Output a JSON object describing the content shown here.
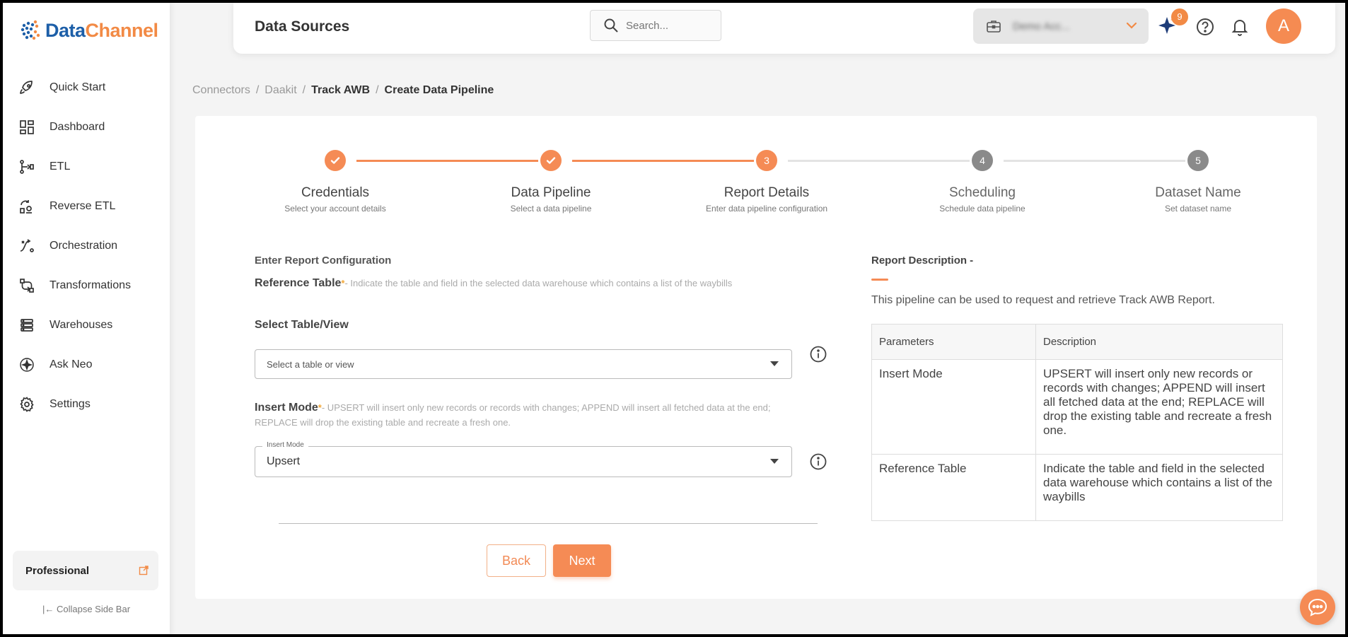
{
  "brand": {
    "name_part1": "Data",
    "name_part2": "Channel",
    "primary": "#1d5fa8",
    "accent": "#f28a45"
  },
  "sidebar": {
    "items": [
      {
        "label": "Quick Start",
        "icon": "rocket-icon"
      },
      {
        "label": "Dashboard",
        "icon": "dashboard-icon"
      },
      {
        "label": "ETL",
        "icon": "etl-icon"
      },
      {
        "label": "Reverse ETL",
        "icon": "reverse-etl-icon"
      },
      {
        "label": "Orchestration",
        "icon": "orchestration-icon"
      },
      {
        "label": "Transformations",
        "icon": "transformations-icon"
      },
      {
        "label": "Warehouses",
        "icon": "warehouses-icon"
      },
      {
        "label": "Ask Neo",
        "icon": "sparkle-icon"
      },
      {
        "label": "Settings",
        "icon": "gear-icon"
      }
    ],
    "plan": "Professional",
    "collapse_label": "Collapse Side Bar"
  },
  "header": {
    "title": "Data Sources",
    "search_placeholder": "Search...",
    "account_name": "Demo Acc...",
    "notification_count": "9",
    "avatar_letter": "A"
  },
  "breadcrumb": {
    "items": [
      "Connectors",
      "Daakit",
      "Track AWB"
    ],
    "current": "Create Data Pipeline"
  },
  "stepper": {
    "steps": [
      {
        "number": "1",
        "title": "Credentials",
        "subtitle": "Select your account details",
        "state": "done"
      },
      {
        "number": "2",
        "title": "Data Pipeline",
        "subtitle": "Select a data pipeline",
        "state": "done"
      },
      {
        "number": "3",
        "title": "Report Details",
        "subtitle": "Enter data pipeline configuration",
        "state": "active"
      },
      {
        "number": "4",
        "title": "Scheduling",
        "subtitle": "Schedule data pipeline",
        "state": "pending"
      },
      {
        "number": "5",
        "title": "Dataset Name",
        "subtitle": "Set dataset name",
        "state": "pending"
      }
    ]
  },
  "form": {
    "section_title": "Enter Report Configuration",
    "reference_table": {
      "label": "Reference Table",
      "required": "*",
      "help": "- Indicate the table and field in the selected data warehouse which contains a list of the waybills"
    },
    "select_table_label": "Select Table/View",
    "select_table_placeholder": "Select a table or view",
    "insert_mode": {
      "label": "Insert Mode",
      "required": "*",
      "help": "- UPSERT will insert only new records or records with changes; APPEND will insert all fetched data at the end; REPLACE will drop the existing table and recreate a fresh one.",
      "field_label": "Insert Mode",
      "value": "Upsert"
    },
    "back_label": "Back",
    "next_label": "Next"
  },
  "description": {
    "title": "Report Description -",
    "text": "This pipeline can be used to request and retrieve Track AWB Report.",
    "table": {
      "headers": [
        "Parameters",
        "Description"
      ],
      "rows": [
        [
          "Insert Mode",
          "UPSERT will insert only new records or records with changes; APPEND will insert all fetched data at the end; REPLACE will drop the existing table and recreate a fresh one."
        ],
        [
          "Reference Table",
          "Indicate the table and field in the selected data warehouse which contains a list of the waybills"
        ]
      ]
    }
  }
}
